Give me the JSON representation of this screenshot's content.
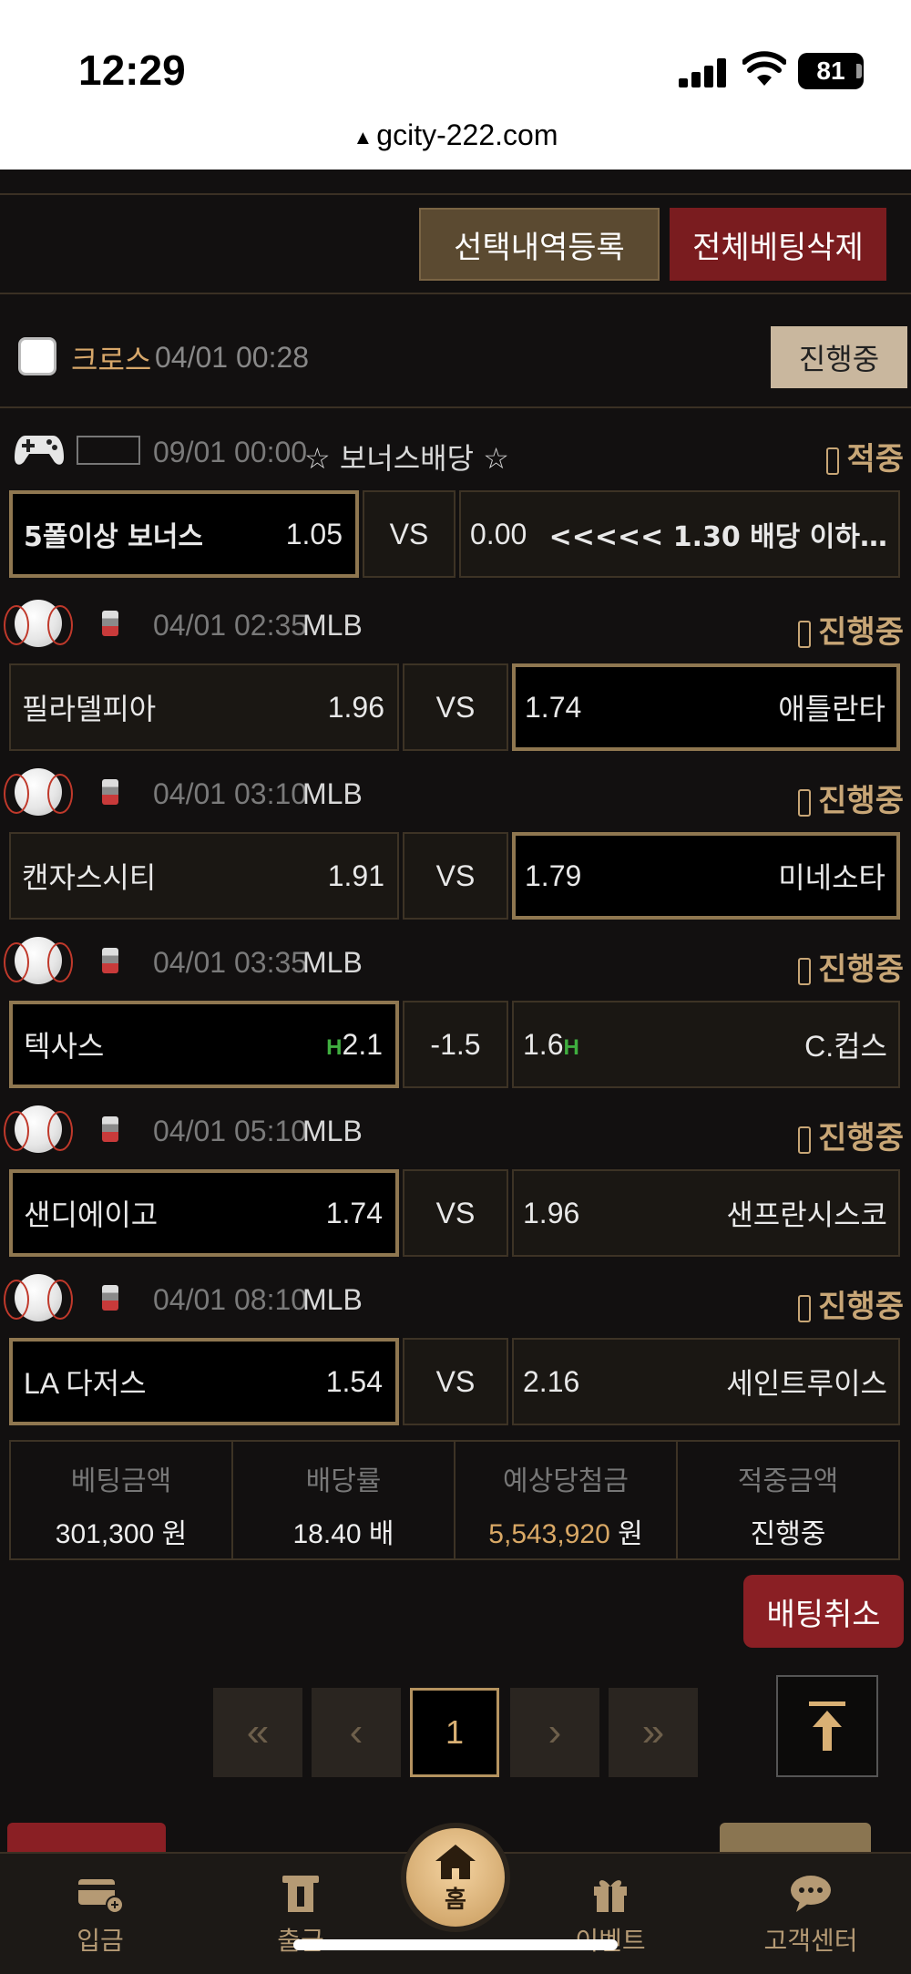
{
  "status_bar": {
    "time": "12:29",
    "battery": "81"
  },
  "browser": {
    "url": "gcity-222.com"
  },
  "actions": {
    "register_selection": "선택내역등록",
    "delete_all_bets": "전체베팅삭제"
  },
  "bet_slip": {
    "type_label": "크로스",
    "datetime": "04/01 00:28",
    "status": "진행중"
  },
  "bonus": {
    "datetime": "09/01 00:00",
    "title": "☆ 보너스배당 ☆",
    "status": "적중",
    "home_name": "5폴이상 보너스",
    "home_odds": "1.05",
    "mid": "VS",
    "away_odds": "0.00",
    "away_name": "<<<<< 1.30 배당 이하…"
  },
  "games": [
    {
      "datetime": "04/01 02:35",
      "league": "MLB",
      "status": "진행중",
      "home": "필라델피아",
      "home_odds": "1.96",
      "mid": "VS",
      "away_odds": "1.74",
      "away": "애틀란타",
      "selected": "away",
      "handicap": false
    },
    {
      "datetime": "04/01 03:10",
      "league": "MLB",
      "status": "진행중",
      "home": "캔자스시티",
      "home_odds": "1.91",
      "mid": "VS",
      "away_odds": "1.79",
      "away": "미네소타",
      "selected": "away",
      "handicap": false
    },
    {
      "datetime": "04/01 03:35",
      "league": "MLB",
      "status": "진행중",
      "home": "텍사스",
      "home_odds": "2.1",
      "mid": "-1.5",
      "away_odds": "1.6",
      "away": "C.컵스",
      "selected": "home",
      "handicap": true,
      "handicap_mark": "H"
    },
    {
      "datetime": "04/01 05:10",
      "league": "MLB",
      "status": "진행중",
      "home": "샌디에이고",
      "home_odds": "1.74",
      "mid": "VS",
      "away_odds": "1.96",
      "away": "샌프란시스코",
      "selected": "home",
      "handicap": false
    },
    {
      "datetime": "04/01 08:10",
      "league": "MLB",
      "status": "진행중",
      "home": "LA 다저스",
      "home_odds": "1.54",
      "mid": "VS",
      "away_odds": "2.16",
      "away": "세인트루이스",
      "selected": "home",
      "handicap": false
    }
  ],
  "summary": {
    "bet_amount_label": "베팅금액",
    "bet_amount": "301,300 원",
    "odds_label": "배당률",
    "odds": "18.40 배",
    "expected_label": "예상당첨금",
    "expected_num": "5,543,920",
    "expected_unit": " 원",
    "win_label": "적중금액",
    "win": "진행중"
  },
  "cancel_bet": "배팅취소",
  "pagination": {
    "first": "«",
    "prev": "‹",
    "current": "1",
    "next": "›",
    "last": "»"
  },
  "bottom_nav": {
    "deposit": "입금",
    "withdraw": "출금",
    "home": "홈",
    "event": "이벤트",
    "support": "고객센터"
  },
  "colors": {
    "accent_gold": "#c8a676",
    "danger_red": "#7a1c1f",
    "background": "#121010"
  }
}
